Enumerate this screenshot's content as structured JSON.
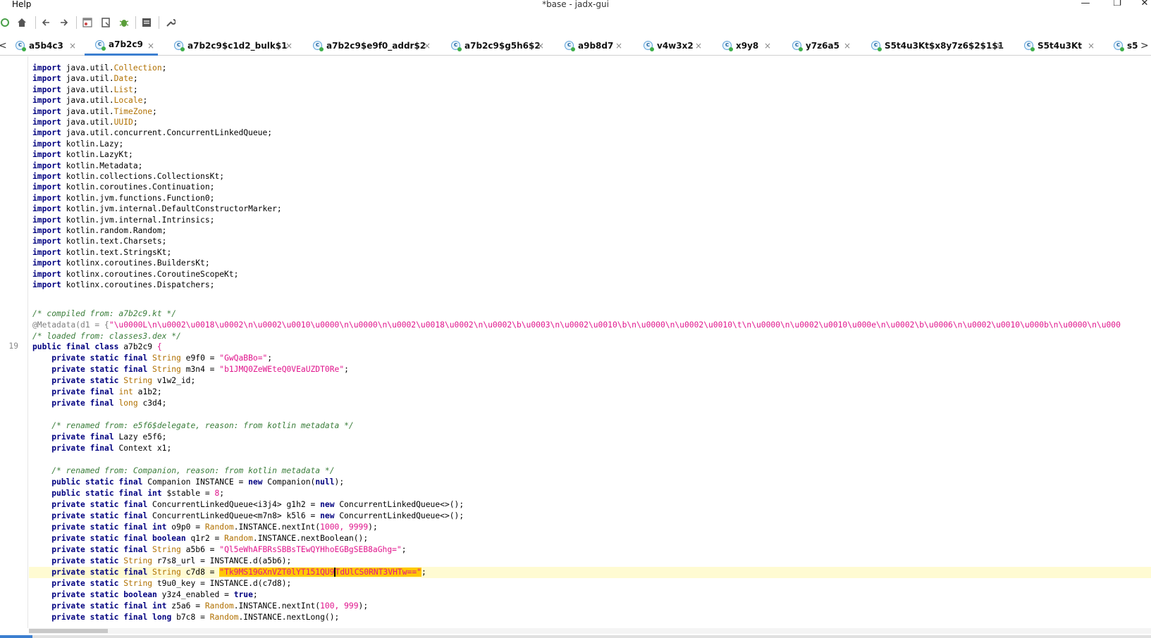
{
  "menu": {
    "help": "Help"
  },
  "window": {
    "title": "*base - jadx-gui",
    "minimize": "—",
    "restore": "❐",
    "close": "✕"
  },
  "toolbar": {
    "icons": [
      "sync-icon",
      "home-icon",
      "back-arrow-icon",
      "forward-arrow-icon",
      "class-tree-icon",
      "bookmark-icon",
      "debug-bug-icon",
      "log-icon",
      "settings-wrench-icon"
    ]
  },
  "tabs": [
    {
      "label": "a5b4c3",
      "active": false
    },
    {
      "label": "a7b2c9",
      "active": true
    },
    {
      "label": "a7b2c9$c1d2_bulk$1",
      "active": false
    },
    {
      "label": "a7b2c9$e9f0_addr$2",
      "active": false
    },
    {
      "label": "a7b2c9$g5h6$2",
      "active": false
    },
    {
      "label": "a9b8d7",
      "active": false
    },
    {
      "label": "v4w3x2",
      "active": false
    },
    {
      "label": "x9y8",
      "active": false
    },
    {
      "label": "y7z6a5",
      "active": false
    },
    {
      "label": "S5t4u3Kt$x8y7z6$2$1$1",
      "active": false
    },
    {
      "label": "S5t4u3Kt",
      "active": false
    },
    {
      "label": "s5",
      "active": false
    }
  ],
  "tab_close": "×",
  "tab_icon_letter": "c",
  "scroll_left": "<",
  "scroll_right": ">",
  "gutter": {
    "line_number": "19"
  },
  "code": {
    "imports": [
      "java.util.Collection",
      "java.util.Date",
      "java.util.List",
      "java.util.Locale",
      "java.util.TimeZone",
      "java.util.UUID",
      "java.util.concurrent.ConcurrentLinkedQueue",
      "kotlin.Lazy",
      "kotlin.LazyKt",
      "kotlin.Metadata",
      "kotlin.collections.CollectionsKt",
      "kotlin.coroutines.Continuation",
      "kotlin.jvm.functions.Function0",
      "kotlin.jvm.internal.DefaultConstructorMarker",
      "kotlin.jvm.internal.Intrinsics",
      "kotlin.random.Random",
      "kotlin.text.Charsets",
      "kotlin.text.StringsKt",
      "kotlinx.coroutines.BuildersKt",
      "kotlinx.coroutines.CoroutineScopeKt",
      "kotlinx.coroutines.Dispatchers"
    ],
    "import_kw": "import",
    "compiled_from": "/* compiled from: a7b2c9.kt */",
    "metadata_prefix": "@Metadata(d1 = {",
    "metadata_value": "\"\\u0000L\\n\\u0002\\u0018\\u0002\\n\\u0002\\u0010\\u0000\\n\\u0000\\n\\u0002\\u0018\\u0002\\n\\u0002\\b\\u0003\\n\\u0002\\u0010\\b\\n\\u0000\\n\\u0002\\u0010\\t\\n\\u0000\\n\\u0002\\u0010\\u000e\\n\\u0002\\b\\u0006\\n\\u0002\\u0010\\u000b\\n\\u0000\\n\\u000",
    "loaded_from": "/* loaded from: classes3.dex */",
    "class_decl": "a7b2c9",
    "e9f0_value": "\"GwQaBBo=\"",
    "m3n4_value": "\"b1JMQ0ZeWEteQ0VEaUZDT0Re\"",
    "comment_e5f6": "/* renamed from: e5f6$delegate, reason: from kotlin metadata */",
    "comment_companion": "/* renamed from: Companion, reason: from kotlin metadata */",
    "stable_value": "8",
    "a5b6_value": "\"Ql5eWhAFBRsSBBsTEwQYHhoEGBgSEB8aGhg=\"",
    "c7d8_selected": "\"Tk9MS19GXnVZT0lYT151QU9",
    "c7d8_rest": "TdUlCS0RNT3VHTw==\"",
    "nextint1": "1000, 9999",
    "nextint2": "100, 999"
  }
}
